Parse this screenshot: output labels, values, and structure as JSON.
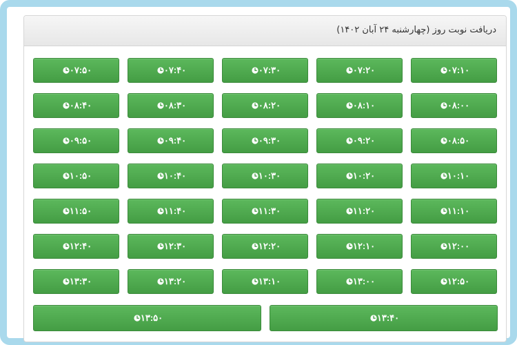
{
  "panel": {
    "title": "دریافت نوبت روز (چهارشنبه ۲۴ آبان ۱۴۰۲)"
  },
  "slot_icon": "clock-icon",
  "slot_color": "#4cae4c",
  "rows": [
    [
      "۰۷:۵۰",
      "۰۷:۴۰",
      "۰۷:۳۰",
      "۰۷:۲۰",
      "۰۷:۱۰"
    ],
    [
      "۰۸:۴۰",
      "۰۸:۳۰",
      "۰۸:۲۰",
      "۰۸:۱۰",
      "۰۸:۰۰"
    ],
    [
      "۰۹:۵۰",
      "۰۹:۴۰",
      "۰۹:۳۰",
      "۰۹:۲۰",
      "۰۸:۵۰"
    ],
    [
      "۱۰:۵۰",
      "۱۰:۴۰",
      "۱۰:۳۰",
      "۱۰:۲۰",
      "۱۰:۱۰"
    ],
    [
      "۱۱:۵۰",
      "۱۱:۴۰",
      "۱۱:۳۰",
      "۱۱:۲۰",
      "۱۱:۱۰"
    ],
    [
      "۱۲:۴۰",
      "۱۲:۳۰",
      "۱۲:۲۰",
      "۱۲:۱۰",
      "۱۲:۰۰"
    ],
    [
      "۱۳:۳۰",
      "۱۳:۲۰",
      "۱۳:۱۰",
      "۱۳:۰۰",
      "۱۲:۵۰"
    ],
    [
      "۱۳:۵۰",
      "۱۳:۴۰"
    ]
  ]
}
